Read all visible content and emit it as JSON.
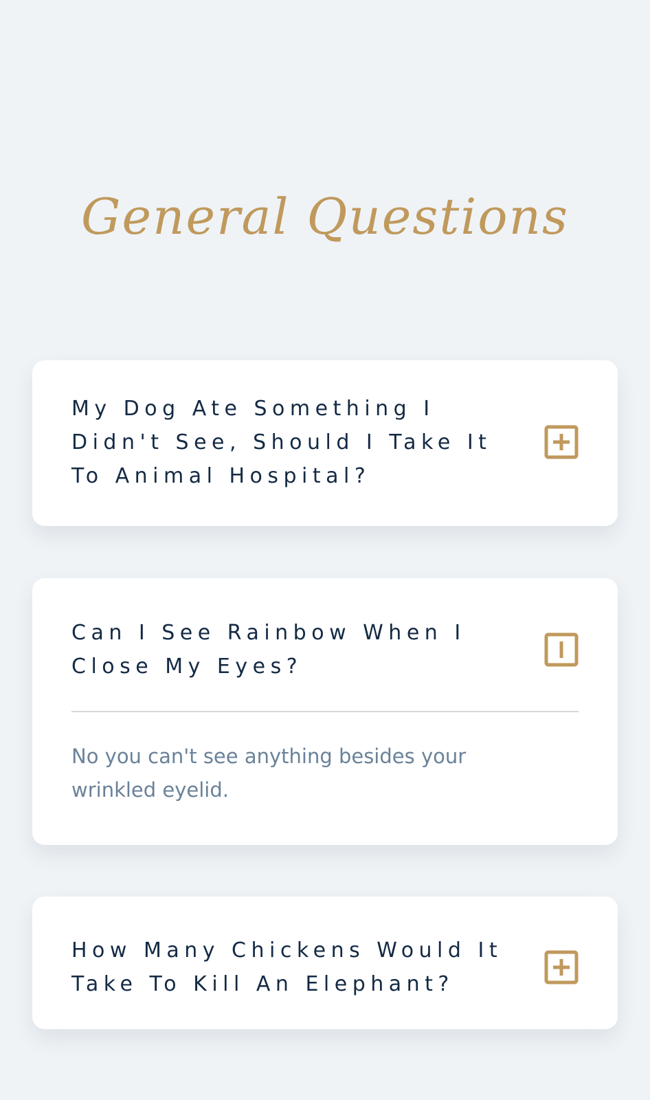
{
  "page": {
    "title": "General Questions"
  },
  "colors": {
    "background": "#eff3f6",
    "accent_gold": "#c0995c",
    "question_text": "#142a44",
    "answer_text": "#6a8299",
    "card": "#ffffff"
  },
  "faq": {
    "items": [
      {
        "question": "My Dog Ate Something I Didn't See, Should I Take It To Animal Hospital?",
        "expanded": false,
        "icon": "plus-square-icon"
      },
      {
        "question": "Can I See Rainbow When I Close My Eyes?",
        "expanded": true,
        "icon": "minus-square-icon",
        "answer": "No you can't see anything besides your wrinkled eyelid."
      },
      {
        "question": "How Many Chickens Would It Take To Kill An Elephant?",
        "expanded": false,
        "icon": "plus-square-icon"
      }
    ]
  }
}
